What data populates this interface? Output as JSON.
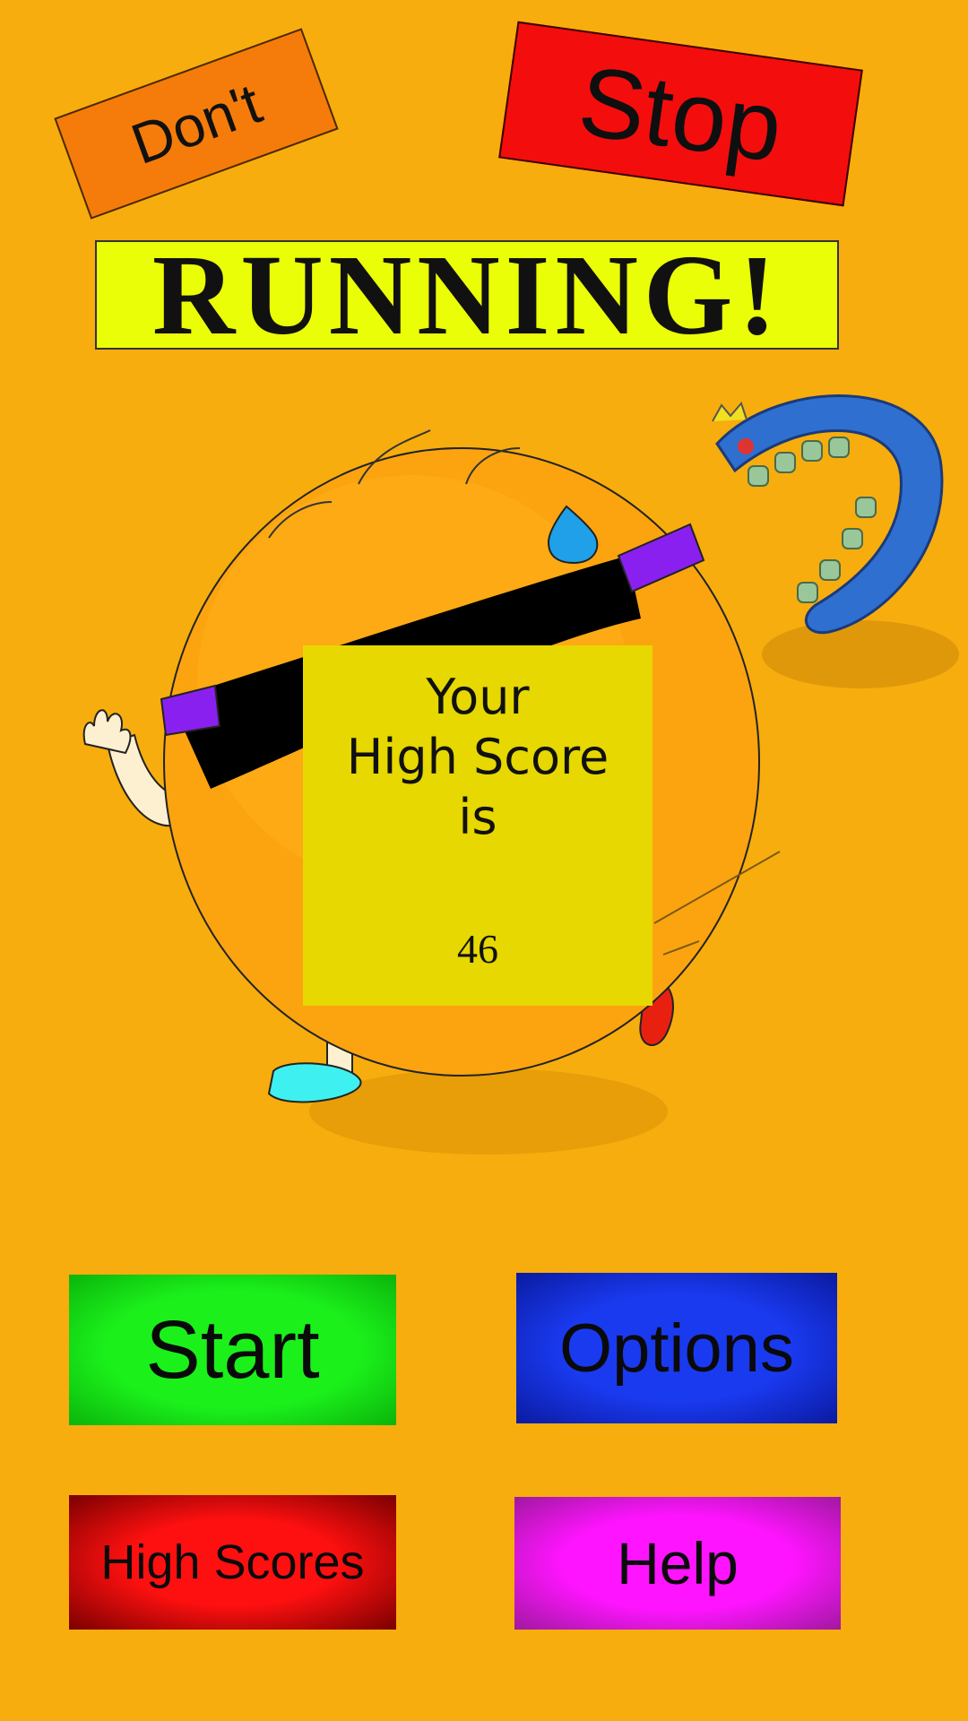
{
  "title": {
    "word1": "Don't",
    "word2": "Stop",
    "word3": "RUNNING!"
  },
  "high_score": {
    "heading_line1": "Your",
    "heading_line2": "High Score",
    "heading_line3": "is",
    "value": "46"
  },
  "menu": {
    "start_label": "Start",
    "options_label": "Options",
    "high_scores_label": "High Scores",
    "help_label": "Help"
  },
  "colors": {
    "background": "#f7ad0d",
    "start": "#1bf01b",
    "options": "#1a3af0",
    "high_scores": "#ff1010",
    "help": "#ff14ff",
    "score_card": "#e6d800"
  },
  "icons": [
    "running-orange-character",
    "blue-serpent-monster"
  ]
}
